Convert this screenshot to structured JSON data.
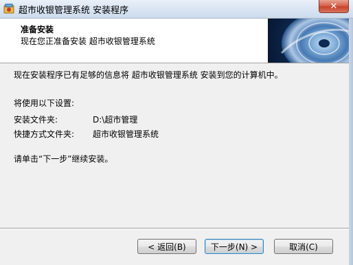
{
  "window": {
    "title": "超市收银管理系统 安装程序",
    "close_glyph": "✕"
  },
  "header": {
    "title": "准备安装",
    "subtitle": "现在您正准备安装 超市收银管理系统"
  },
  "body": {
    "intro": "现在安装程序已有足够的信息将 超市收银管理系统 安装到您的计算机中。",
    "settings_heading": "将使用以下设置:",
    "install_folder_label": "安装文件夹:",
    "install_folder_value": "D:\\超市管理",
    "shortcut_folder_label": "快捷方式文件夹:",
    "shortcut_folder_value": "超市收银管理系统",
    "instruction": "请单击“下一步”继续安装。"
  },
  "buttons": {
    "back": "< 返回(B)",
    "next": "下一步(N) >",
    "cancel": "取消(C)"
  }
}
